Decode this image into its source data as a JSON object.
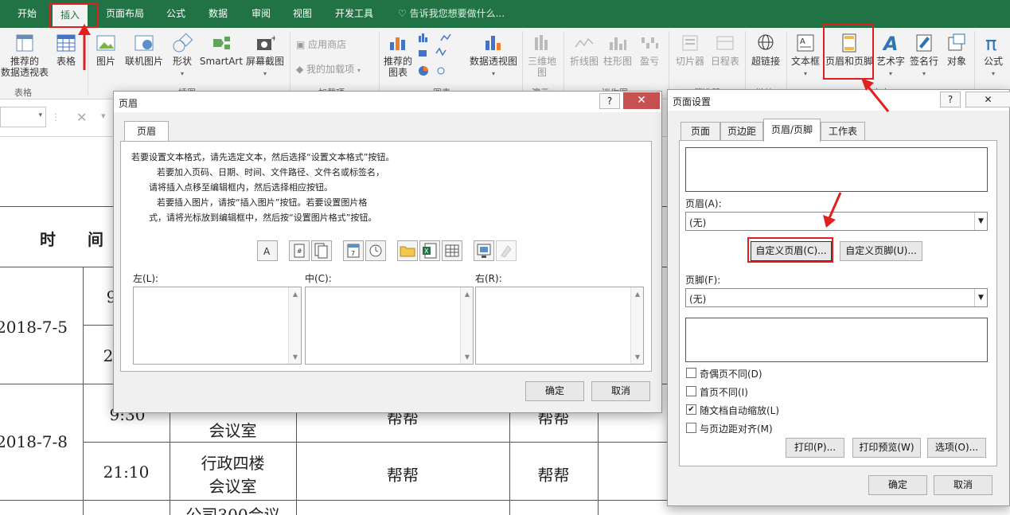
{
  "ribbon_tabs": [
    "开始",
    "插入",
    "页面布局",
    "公式",
    "数据",
    "审阅",
    "视图",
    "开发工具"
  ],
  "tell_me": "告诉我您想要做什么...",
  "ribbon": {
    "recommended_pivot": "推荐的\n数据透视表",
    "table": "表格",
    "picture": "图片",
    "online_picture": "联机图片",
    "shapes": "形状",
    "smartart": "SmartArt",
    "screenshot": "屏幕截图",
    "app_store": "应用商店",
    "my_addins": "我的加载项",
    "recommended_charts": "推荐的\n图表",
    "pivot_chart": "数据透视图",
    "map_3d": "三维地\n图",
    "line_spark": "折线图",
    "column_spark": "柱形图",
    "winloss": "盈亏",
    "slicer": "切片器",
    "timeline": "日程表",
    "hyperlink": "超链接",
    "textbox": "文本框",
    "header_footer": "页眉和页脚",
    "wordart": "艺术字",
    "signature": "签名行",
    "object": "对象",
    "formula": "公式",
    "group_tables": "表格",
    "group_illustrations": "插图",
    "group_addins": "加载项",
    "group_charts": "图表",
    "group_tours": "演示",
    "group_sparklines": "迷你图",
    "group_filters": "筛选器",
    "group_links": "链接",
    "group_text": "文本"
  },
  "formula_bar": {
    "cancel": "✕"
  },
  "sheet": {
    "header_time": "时　　间",
    "date1": "2018-7-5",
    "t1": "9",
    "t2": "2",
    "date2": "2018-7-8",
    "t3": "9:30",
    "room3": "会议室",
    "name3a": "帮帮",
    "name3b": "帮帮",
    "t4": "21:10",
    "room4a": "行政四楼",
    "room4b": "会议室",
    "name4a": "帮帮",
    "name4b": "帮帮",
    "room5": "公司300会议"
  },
  "header_dialog": {
    "title": "页眉",
    "tab": "页眉",
    "instr1": "若要设置文本格式，请先选定文本，然后选择“设置文本格式”按钮。",
    "instr2": "若要加入页码、日期、时间、文件路径、文件名或标签名，",
    "instr3": "请将插入点移至编辑框内，然后选择相应按钮。",
    "instr4": "若要插入图片，请按“插入图片”按钮。若要设置图片格",
    "instr5": "式，请将光标放到编辑框中，然后按“设置图片格式”按钮。",
    "left_label": "左(L):",
    "center_label": "中(C):",
    "right_label": "右(R):",
    "ok": "确定",
    "cancel": "取消",
    "help": "?",
    "close": "✕"
  },
  "page_setup": {
    "title": "页面设置",
    "tabs": [
      "页面",
      "页边距",
      "页眉/页脚",
      "工作表"
    ],
    "header_label": "页眉(A):",
    "header_value": "(无)",
    "custom_header": "自定义页眉(C)...",
    "custom_footer": "自定义页脚(U)...",
    "footer_label": "页脚(F):",
    "footer_value": "(无)",
    "odd_even": "奇偶页不同(D)",
    "first_page": "首页不同(I)",
    "scale_with_doc": "随文档自动缩放(L)",
    "align_margins": "与页边距对齐(M)",
    "print": "打印(P)...",
    "print_preview": "打印预览(W)",
    "options": "选项(O)...",
    "ok": "确定",
    "cancel": "取消",
    "help": "?"
  },
  "colors": {
    "excel_green": "#217346",
    "annotation_red": "#e02020"
  }
}
